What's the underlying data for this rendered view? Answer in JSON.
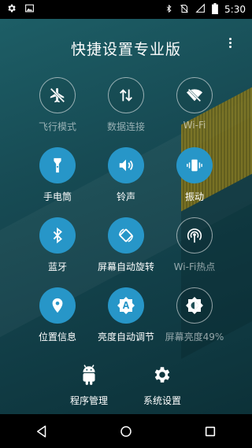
{
  "status_bar": {
    "time": "5:30",
    "left_icons": [
      "settings-gear-icon",
      "image-icon"
    ],
    "right_icons": [
      "bluetooth-icon",
      "no-sim-icon",
      "signal-icon",
      "battery-icon"
    ]
  },
  "app": {
    "title": "快捷设置专业版",
    "menu_icon": "more-vert-icon"
  },
  "tiles": [
    {
      "label": "飞行模式",
      "icon": "airplane-off-icon",
      "state": "off"
    },
    {
      "label": "数据连接",
      "icon": "data-transfer-icon",
      "state": "off"
    },
    {
      "label": "Wi-Fi",
      "icon": "wifi-off-icon",
      "state": "off"
    },
    {
      "label": "手电筒",
      "icon": "flashlight-icon",
      "state": "on"
    },
    {
      "label": "铃声",
      "icon": "volume-icon",
      "state": "on"
    },
    {
      "label": "振动",
      "icon": "vibrate-icon",
      "state": "on"
    },
    {
      "label": "蓝牙",
      "icon": "bluetooth-icon",
      "state": "on"
    },
    {
      "label": "屏幕自动旋转",
      "icon": "screen-rotation-icon",
      "state": "on"
    },
    {
      "label": "Wi-Fi热点",
      "icon": "hotspot-icon",
      "state": "off"
    },
    {
      "label": "位置信息",
      "icon": "location-icon",
      "state": "on"
    },
    {
      "label": "亮度自动调节",
      "icon": "brightness-auto-icon",
      "state": "on"
    },
    {
      "label": "屏幕亮度49%",
      "icon": "brightness-icon",
      "state": "off"
    }
  ],
  "bottom_buttons": [
    {
      "label": "程序管理",
      "icon": "android-icon"
    },
    {
      "label": "系统设置",
      "icon": "settings-icon"
    }
  ],
  "nav_bar": [
    "back-icon",
    "home-icon",
    "recents-icon"
  ],
  "colors": {
    "accent": "#2796c8",
    "background": "#174b54",
    "status_bar": "#000000"
  }
}
